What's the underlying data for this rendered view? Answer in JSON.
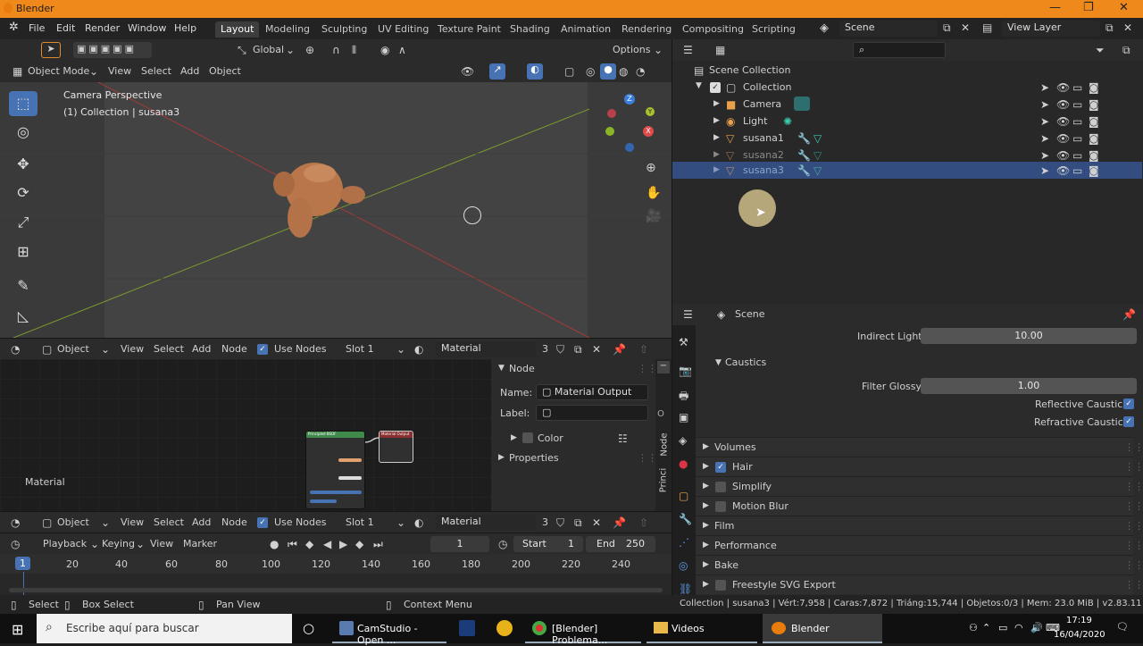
{
  "window": {
    "title": "Blender",
    "controls": [
      "—",
      "❐",
      "✕"
    ]
  },
  "menubar": {
    "items": [
      "File",
      "Edit",
      "Render",
      "Window",
      "Help"
    ],
    "workspaces": [
      "Layout",
      "Modeling",
      "Sculpting",
      "UV Editing",
      "Texture Paint",
      "Shading",
      "Animation",
      "Rendering",
      "Compositing",
      "Scripting"
    ],
    "active_workspace": "Layout",
    "scene": "Scene",
    "view_layer": "View Layer"
  },
  "toolbar": {
    "orientation": "Global",
    "options": "Options"
  },
  "viewport": {
    "mode": "Object Mode",
    "menus": [
      "View",
      "Select",
      "Add",
      "Object"
    ],
    "overlay_title": "Camera Perspective",
    "overlay_subtitle": "(1) Collection | susana3",
    "gizmo_axes": [
      "X",
      "Y",
      "Z"
    ]
  },
  "outliner": {
    "search_placeholder": "",
    "rows": [
      {
        "label": "Scene Collection",
        "level": 0
      },
      {
        "label": "Collection",
        "level": 1
      },
      {
        "label": "Camera",
        "level": 2
      },
      {
        "label": "Light",
        "level": 2
      },
      {
        "label": "susana1",
        "level": 2
      },
      {
        "label": "susana2",
        "level": 2
      },
      {
        "label": "susana3",
        "level": 2
      }
    ]
  },
  "properties": {
    "title": "Scene",
    "indirect_light_label": "Indirect Light",
    "indirect_light_value": "10.00",
    "caustics_label": "Caustics",
    "filter_glossy_label": "Filter Glossy",
    "filter_glossy_value": "1.00",
    "reflective_label": "Reflective Caustics",
    "refractive_label": "Refractive Caustics",
    "sections": [
      "Volumes",
      "Hair",
      "Simplify",
      "Motion Blur",
      "Film",
      "Performance",
      "Bake",
      "Freestyle SVG Export"
    ]
  },
  "node_editor": {
    "type": "Object",
    "menus": [
      "View",
      "Select",
      "Add",
      "Node"
    ],
    "use_nodes": "Use Nodes",
    "slot": "Slot 1",
    "material": "Material",
    "users": "3",
    "corner_label": "Material",
    "side_tabs": [
      "Node",
      "Princi"
    ],
    "node_panel": {
      "title": "Node",
      "name_label": "Name:",
      "name_value": "Material Output",
      "label_label": "Label:",
      "color_label": "Color",
      "properties_label": "Properties"
    },
    "node_bsdf_title": "Principled BSDF",
    "node_output_title": "Material Output"
  },
  "node_editor2": {
    "type": "Object",
    "menus": [
      "View",
      "Select",
      "Add",
      "Node"
    ],
    "use_nodes": "Use Nodes",
    "slot": "Slot 1",
    "material": "Material",
    "users": "3"
  },
  "timeline": {
    "menus": [
      "Playback",
      "Keying",
      "View",
      "Marker"
    ],
    "current_frame": "1",
    "start_label": "Start",
    "start_value": "1",
    "end_label": "End",
    "end_value": "250",
    "ticks": [
      "1",
      "20",
      "40",
      "60",
      "80",
      "100",
      "120",
      "140",
      "160",
      "180",
      "200",
      "220",
      "240"
    ]
  },
  "statusbar": {
    "select": "Select",
    "box_select": "Box Select",
    "pan_view": "Pan View",
    "context_menu": "Context Menu",
    "info": "Collection | susana3 | Vért:7,958 | Caras:7,872 | Triáng:15,744 | Objetos:0/3 | Mem: 23.0 MiB | v2.83.11"
  },
  "taskbar": {
    "search_placeholder": "Escribe aquí para buscar",
    "apps": [
      "CamStudio - Open ...",
      "[Blender] Problema...",
      "Videos",
      "Blender"
    ],
    "time": "17:19",
    "date": "16/04/2020"
  },
  "colors": {
    "accent": "#4772b3",
    "title_bar": "#f0891c",
    "selection": "#334d80",
    "suzanne": "#b9764a"
  }
}
